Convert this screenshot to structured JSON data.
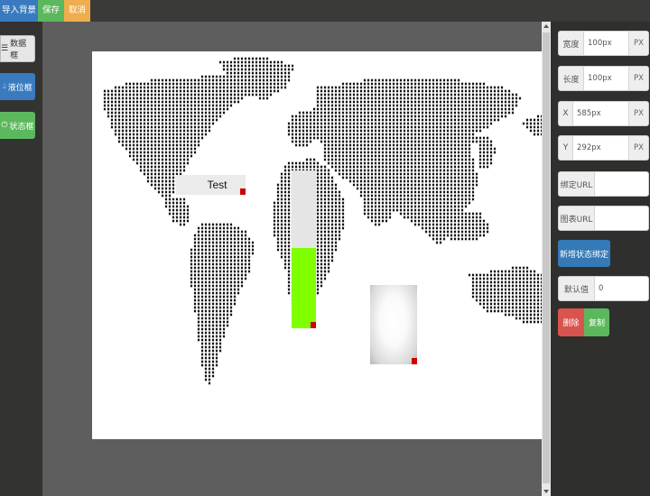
{
  "toolbar": {
    "import_bg": "导入背景",
    "save": "保存",
    "cancel": "取消"
  },
  "tools": {
    "data_box": "数据框",
    "level_box": "液位框",
    "status_box": "状态框"
  },
  "widgets": {
    "data_label": "Test",
    "level_fill_fraction": 0.51
  },
  "properties": {
    "width_label": "宽度",
    "width_value": "100px",
    "height_label": "长度",
    "height_value": "100px",
    "x_label": "X",
    "x_value": "585px",
    "y_label": "Y",
    "y_value": "292px",
    "unit": "PX",
    "bind_url_label": "绑定URL",
    "bind_url_value": "",
    "chart_url_label": "图表URL",
    "chart_url_value": "",
    "add_status_binding": "新增状态绑定",
    "default_label": "默认值",
    "default_value": "0",
    "delete": "删除",
    "copy": "复制"
  },
  "colors": {
    "level_fill": "#80ff00",
    "handle": "#cc0000",
    "primary": "#337ab7",
    "success": "#5cb85c",
    "warning": "#f0ad4e",
    "danger": "#d9534f"
  }
}
